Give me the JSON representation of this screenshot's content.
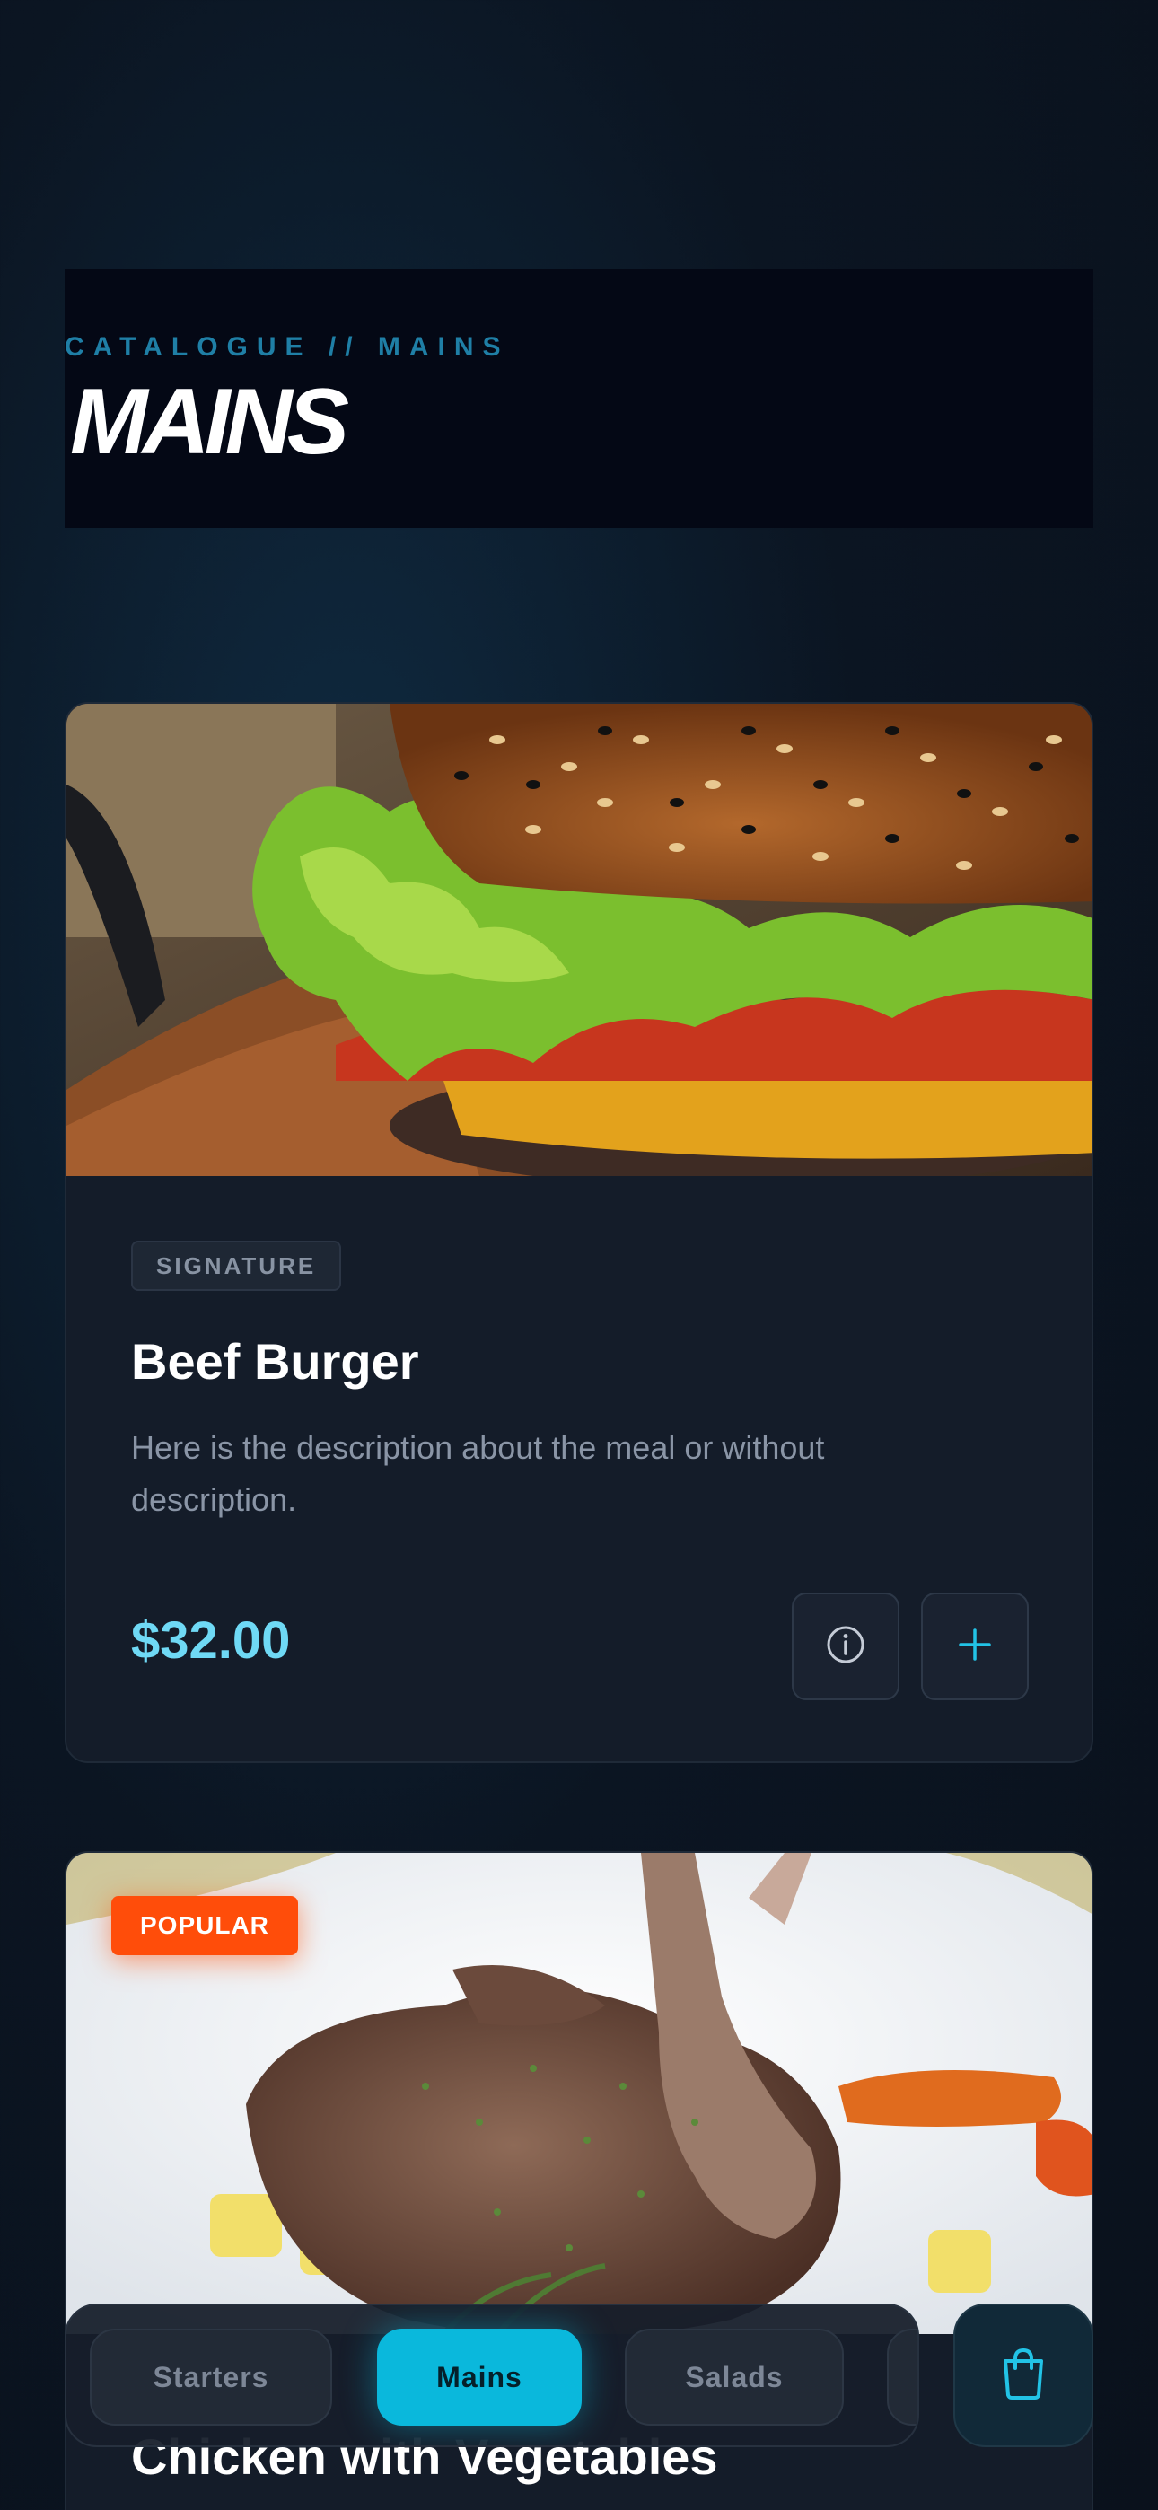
{
  "header": {
    "eyebrow": "CATALOGUE // MAINS",
    "title": "MAINS"
  },
  "items": [
    {
      "tag": "SIGNATURE",
      "name": "Beef Burger",
      "description": "Here is the description about the meal or without description.",
      "price": "$32.00",
      "image": "beef-burger-photo"
    },
    {
      "badge": "POPULAR",
      "name": "Chicken with Vegetables",
      "image": "grilled-meat-with-vegetables-photo"
    }
  ],
  "nav": {
    "tabs": [
      "Starters",
      "Mains",
      "Salads",
      ""
    ],
    "active": "Mains",
    "cart_icon": "shopping-bag-icon"
  },
  "colors": {
    "accent": "#0ab8dc",
    "price": "#6fd9f5",
    "popular": "#ff4d0a",
    "background": "#0b1522"
  }
}
